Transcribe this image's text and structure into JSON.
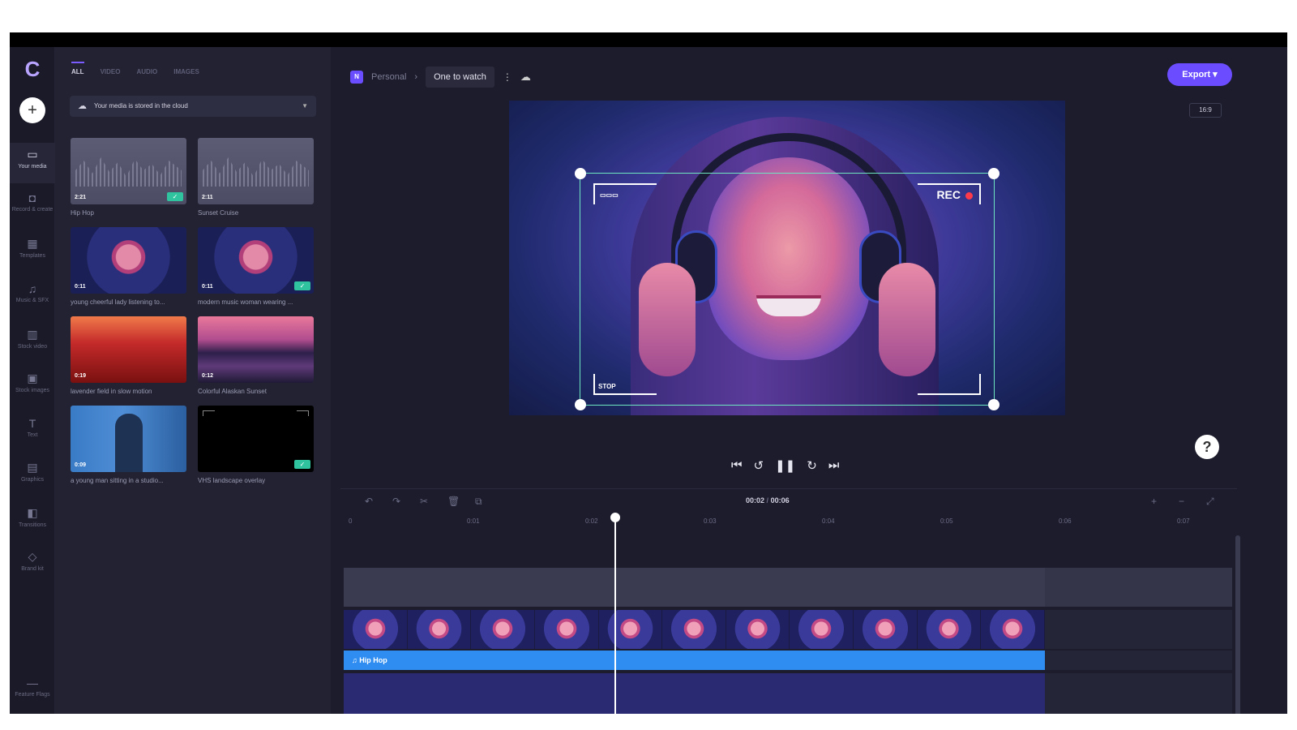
{
  "rail": {
    "items": [
      {
        "icon": "your-media-icon",
        "label": "Your media",
        "active": true
      },
      {
        "icon": "record-create-icon",
        "label": "Record & create"
      },
      {
        "icon": "templates-icon",
        "label": "Templates"
      },
      {
        "icon": "music-sfx-icon",
        "label": "Music & SFX"
      },
      {
        "icon": "stock-video-icon",
        "label": "Stock video"
      },
      {
        "icon": "stock-images-icon",
        "label": "Stock images"
      },
      {
        "icon": "text-icon",
        "label": "Text"
      },
      {
        "icon": "graphics-icon",
        "label": "Graphics"
      },
      {
        "icon": "transitions-icon",
        "label": "Transitions"
      },
      {
        "icon": "brand-kit-icon",
        "label": "Brand kit"
      }
    ],
    "feature_flags_label": "Feature Flags"
  },
  "media": {
    "tabs": [
      "ALL",
      "VIDEO",
      "AUDIO",
      "IMAGES"
    ],
    "cloud_notice": "Your media is stored in the cloud",
    "items": [
      {
        "caption": "Hip Hop",
        "duration": "2:21",
        "kind": "audio",
        "added": true
      },
      {
        "caption": "Sunset Cruise",
        "duration": "2:11",
        "kind": "audio",
        "added": false
      },
      {
        "caption": "young cheerful lady listening to...",
        "duration": "0:11",
        "kind": "video",
        "added": false
      },
      {
        "caption": "modern music woman wearing ...",
        "duration": "0:11",
        "kind": "video",
        "added": true
      },
      {
        "caption": "lavender field in slow motion",
        "duration": "0:19",
        "kind": "video",
        "added": false
      },
      {
        "caption": "Colorful Alaskan Sunset",
        "duration": "0:12",
        "kind": "video",
        "added": false
      },
      {
        "caption": "a young man sitting in a studio...",
        "duration": "0:09",
        "kind": "video",
        "added": false
      },
      {
        "caption": "VHS landscape overlay",
        "duration": "",
        "kind": "overlay",
        "added": true
      }
    ]
  },
  "header": {
    "workspace": "Personal",
    "project": "One to watch",
    "export_label": "Export",
    "ratio": "16:9"
  },
  "preview": {
    "rec_label": "REC",
    "stop_label": "STOP"
  },
  "timeline": {
    "current": "00:02",
    "total": "00:06",
    "ruler": [
      "0",
      "0:01",
      "0:02",
      "0:03",
      "0:04",
      "0:05",
      "0:06",
      "0:07"
    ],
    "audio_clip": "Hip Hop"
  }
}
